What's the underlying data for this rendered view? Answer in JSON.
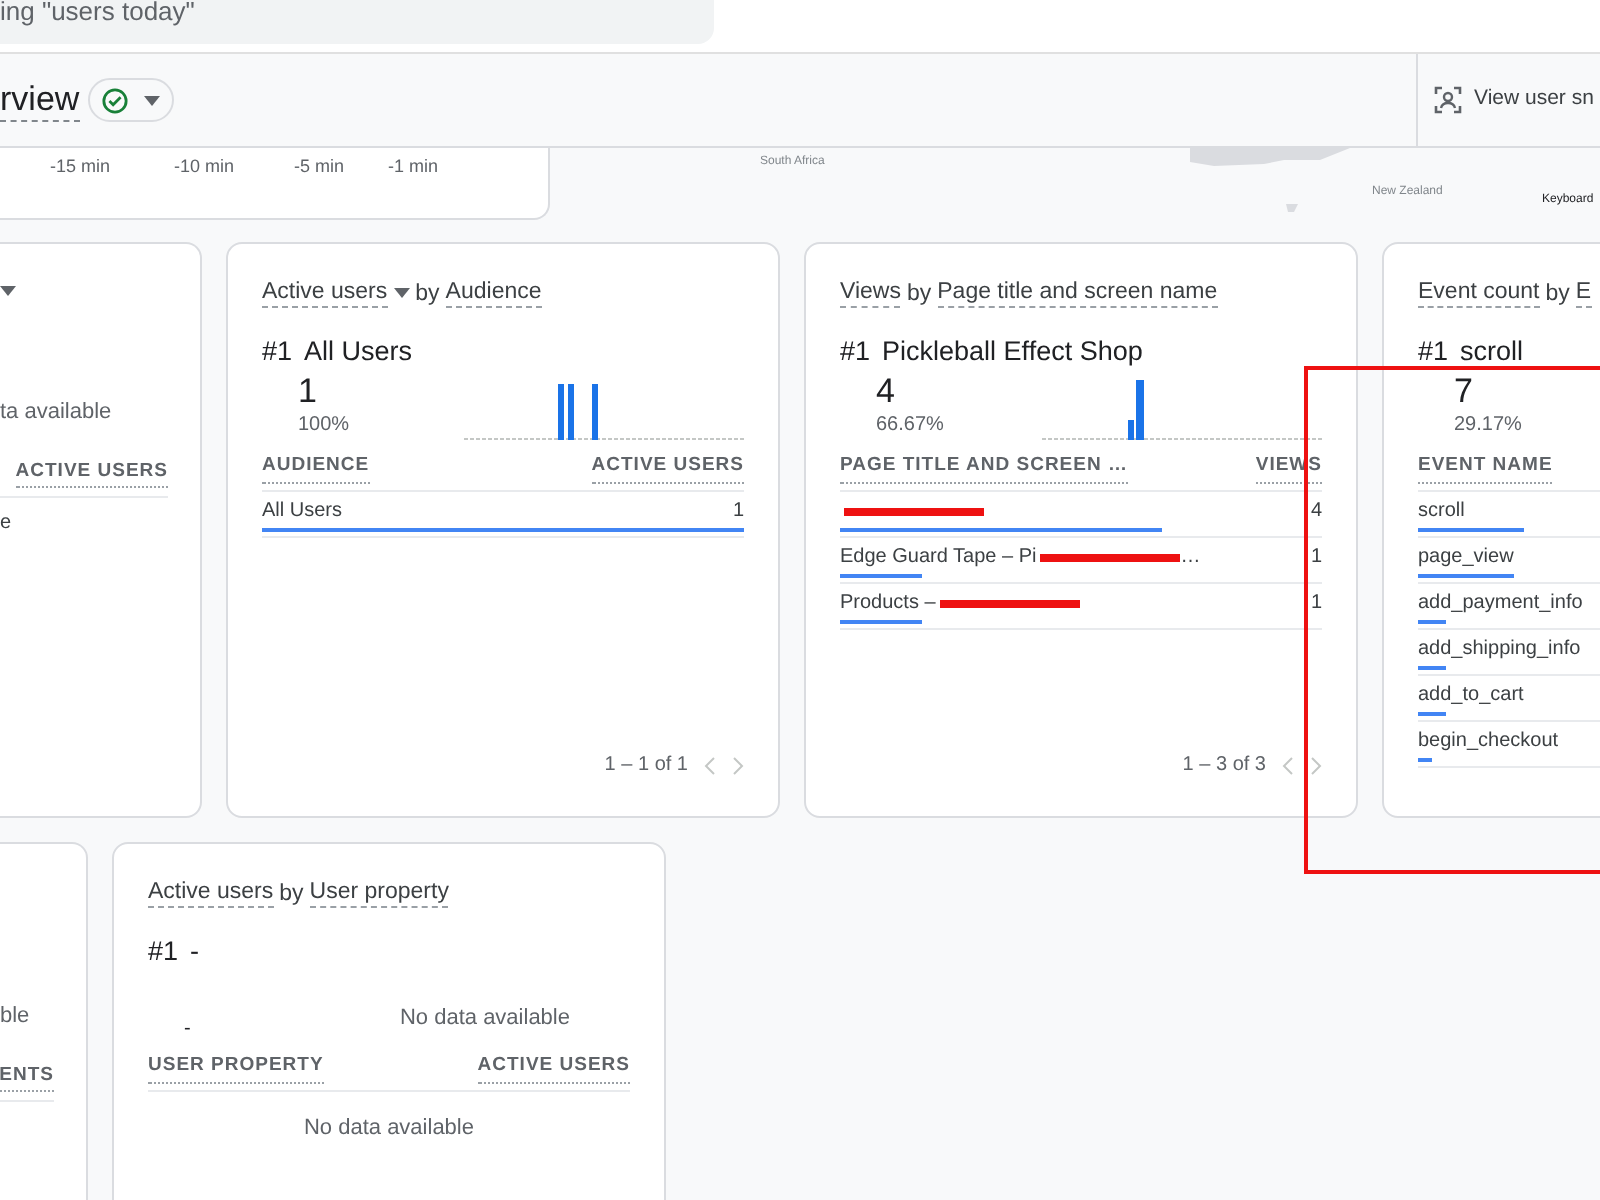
{
  "search": {
    "value": "ing \"users today\""
  },
  "header": {
    "title": "rview",
    "status_ok": true,
    "action": "View user sn"
  },
  "timeline": {
    "ticks": [
      "-15 min",
      "-10 min",
      "-5 min",
      "-1 min"
    ]
  },
  "map": {
    "labels": [
      "South Africa",
      "New Zealand",
      "Keyboard"
    ]
  },
  "cards_row_1": [
    {
      "kind": "clipped",
      "title": {
        "dropdown": true
      },
      "no_data": "ta available",
      "columns": [
        "ACTIVE USERS"
      ],
      "rows": [
        {
          "label": "e"
        }
      ]
    },
    {
      "kind": "full",
      "title": {
        "metric": "Active users",
        "dropdown": true,
        "by": "by",
        "dimension": "Audience"
      },
      "top": {
        "rank": "#1",
        "name": "All Users",
        "value": "1",
        "share": "100%"
      },
      "columns": [
        "AUDIENCE",
        "ACTIVE USERS"
      ],
      "rows": [
        {
          "label": "All Users",
          "value": "1",
          "level": 1
        }
      ],
      "pagination": "1 – 1 of 1"
    },
    {
      "kind": "full",
      "title": {
        "metric": "Views",
        "dropdown": false,
        "by": "by",
        "dimension": "Page title and screen name"
      },
      "top": {
        "rank": "#1",
        "name": "Pickleball Effect Shop",
        "value": "4",
        "share": "66.67%"
      },
      "columns": [
        "PAGE TITLE AND SCREEN …",
        "VIEWS"
      ],
      "rows": [
        {
          "redacted": true,
          "value": "4",
          "level": 0.67
        },
        {
          "label": "Edge Guard Tape – Pi",
          "redacted": true,
          "tail": "…",
          "value": "1",
          "level": 0.17
        },
        {
          "label": "Products –",
          "redacted": true,
          "value": "1",
          "level": 0.17
        }
      ],
      "pagination": "1 – 3 of 3"
    },
    {
      "kind": "full",
      "title": {
        "metric": "Event count",
        "dropdown": false,
        "by": "by",
        "dimension": "E"
      },
      "top": {
        "rank": "#1",
        "name": "scroll",
        "value": "7",
        "share": "29.17%"
      },
      "columns": [
        "EVENT NAME"
      ],
      "rows": [
        {
          "label": "scroll",
          "level": 0.22
        },
        {
          "label": "page_view",
          "level": 0.2
        },
        {
          "label": "add_payment_info",
          "level": 0.06
        },
        {
          "label": "add_shipping_info",
          "level": 0.06
        },
        {
          "label": "add_to_cart",
          "level": 0.06
        },
        {
          "label": "begin_checkout",
          "level": 0.03
        }
      ]
    }
  ],
  "cards_row_2": [
    {
      "kind": "clipped",
      "no_data": "ble",
      "columns": [
        "ENTS"
      ]
    },
    {
      "kind": "full",
      "title": {
        "metric": "Active users",
        "dropdown": false,
        "by": "by",
        "dimension": "User property"
      },
      "top": {
        "rank": "#1",
        "name": "-",
        "value": "-"
      },
      "top_no_data": "No data available",
      "columns": [
        "USER PROPERTY",
        "ACTIVE USERS"
      ],
      "no_data": "No data available"
    }
  ]
}
